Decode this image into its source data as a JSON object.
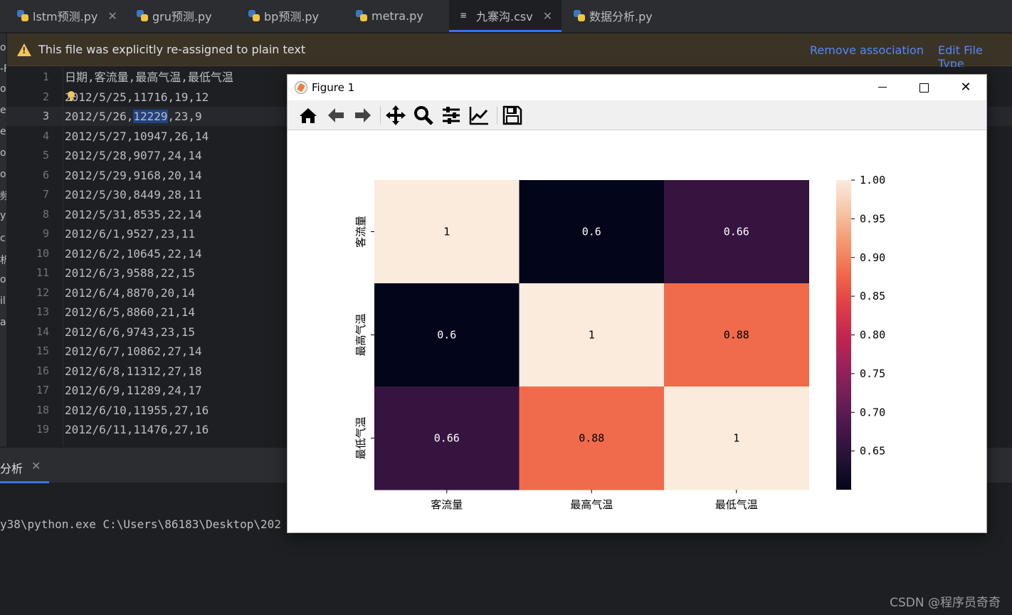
{
  "tabs": [
    {
      "label": "lstm预测.py",
      "icon": "python-file-icon",
      "closable": true
    },
    {
      "label": "gru预测.py",
      "icon": "python-file-icon"
    },
    {
      "label": "bp预测.py",
      "icon": "python-file-icon"
    },
    {
      "label": "metra.py",
      "icon": "python-file-icon"
    },
    {
      "label": "九寨沟.csv",
      "icon": "text-file-icon",
      "closable": true,
      "active": true
    },
    {
      "label": "数据分析.py",
      "icon": "python-file-icon"
    }
  ],
  "notice": {
    "message": "This file was explicitly re-assigned to plain text",
    "remove_link": "Remove association",
    "edit_link": "Edit File Type"
  },
  "left_strip": [
    "o",
    "-F",
    "oc",
    "ea",
    "el.",
    "o",
    "o",
    "频",
    "y",
    "c",
    "析",
    "or",
    "il",
    "a"
  ],
  "editor": {
    "lines": [
      {
        "n": "1",
        "text": "日期,客流量,最高气温,最低气温"
      },
      {
        "n": "2",
        "text": "2012/5/25,11716,19,12"
      },
      {
        "n": "3",
        "pre": "2012/5/26,",
        "sel": "12229",
        "post": ",23,9"
      },
      {
        "n": "4",
        "text": "2012/5/27,10947,26,14"
      },
      {
        "n": "5",
        "text": "2012/5/28,9077,24,14"
      },
      {
        "n": "6",
        "text": "2012/5/29,9168,20,14"
      },
      {
        "n": "7",
        "text": "2012/5/30,8449,28,11"
      },
      {
        "n": "8",
        "text": "2012/5/31,8535,22,14"
      },
      {
        "n": "9",
        "text": "2012/6/1,9527,23,11"
      },
      {
        "n": "10",
        "text": "2012/6/2,10645,22,14"
      },
      {
        "n": "11",
        "text": "2012/6/3,9588,22,15"
      },
      {
        "n": "12",
        "text": "2012/6/4,8870,20,14"
      },
      {
        "n": "13",
        "text": "2012/6/5,8860,21,14"
      },
      {
        "n": "14",
        "text": "2012/6/6,9743,23,15"
      },
      {
        "n": "15",
        "text": "2012/6/7,10862,27,14"
      },
      {
        "n": "16",
        "text": "2012/6/8,11312,27,18"
      },
      {
        "n": "17",
        "text": "2012/6/9,11289,24,17"
      },
      {
        "n": "18",
        "text": "2012/6/10,11955,27,16"
      },
      {
        "n": "19",
        "text": "2012/6/11,11476,27,16"
      }
    ]
  },
  "run_panel": {
    "tab_label": "分析",
    "command": "y38\\python.exe C:\\Users\\86183\\Desktop\\202"
  },
  "figure": {
    "title": "Figure 1",
    "toolbar": [
      "home-icon",
      "back-icon",
      "forward-icon",
      "pan-icon",
      "zoom-icon",
      "configure-subplots-icon",
      "edit-axis-icon",
      "save-icon"
    ]
  },
  "chart_data": {
    "type": "heatmap",
    "row_labels": [
      "客流量",
      "最高气温",
      "最低气温"
    ],
    "col_labels": [
      "客流量",
      "最高气温",
      "最低气温"
    ],
    "values": [
      [
        1,
        0.6,
        0.66
      ],
      [
        0.6,
        1,
        0.88
      ],
      [
        0.66,
        0.88,
        1
      ]
    ],
    "annotations": [
      [
        "1",
        "0.6",
        "0.66"
      ],
      [
        "0.6",
        "1",
        "0.88"
      ],
      [
        "0.66",
        "0.88",
        "1"
      ]
    ],
    "colormap": "rocket",
    "vmin": 0.6,
    "vmax": 1.0,
    "colorbar_ticks": [
      "1.00",
      "0.95",
      "0.90",
      "0.85",
      "0.80",
      "0.75",
      "0.70",
      "0.65"
    ],
    "colorbar_tick_values": [
      1.0,
      0.95,
      0.9,
      0.85,
      0.8,
      0.75,
      0.7,
      0.65
    ]
  },
  "watermark": "CSDN @程序员奇奇",
  "colors": {
    "accent": "#3574f0",
    "warning": "#f2c55c",
    "link": "#548af7"
  }
}
